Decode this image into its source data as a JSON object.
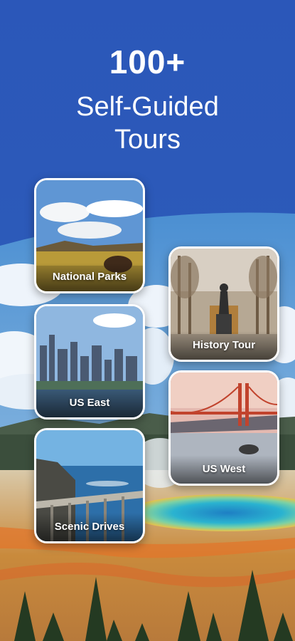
{
  "hero": {
    "count": "100+",
    "line1": "Self-Guided",
    "line2": "Tours"
  },
  "cards": [
    {
      "label": "National Parks",
      "icon": "bison-meadow-image"
    },
    {
      "label": "History Tour",
      "icon": "statue-plaza-image"
    },
    {
      "label": "US East",
      "icon": "city-skyline-image"
    },
    {
      "label": "US West",
      "icon": "golden-gate-bridge-image"
    },
    {
      "label": "Scenic Drives",
      "icon": "coastal-bridge-image"
    }
  ],
  "colors": {
    "brand_blue": "#2b57b9",
    "card_border": "#ffffff",
    "text": "#ffffff"
  }
}
